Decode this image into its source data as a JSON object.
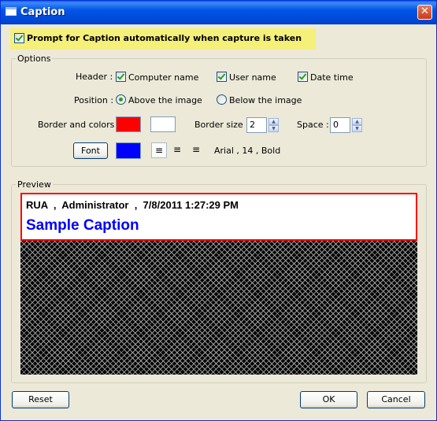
{
  "window": {
    "title": "Caption",
    "close_glyph": "✕"
  },
  "prompt": {
    "label": "Prompt for Caption automatically when capture is taken",
    "checked": true
  },
  "options": {
    "group_label": "Options",
    "header_label": "Header :",
    "header_items": [
      {
        "label": "Computer name",
        "checked": true
      },
      {
        "label": "User name",
        "checked": true
      },
      {
        "label": "Date time",
        "checked": true
      }
    ],
    "position_label": "Position :",
    "position_options": [
      {
        "label": "Above the image",
        "selected": true
      },
      {
        "label": "Below the image",
        "selected": false
      }
    ],
    "border_colors_label": "Border and colors :",
    "border_color": "#FF0000",
    "background_color": "#FFFFFF",
    "border_size_label": "Border size :",
    "border_size_value": "2",
    "space_label": "Space :",
    "space_value": "0",
    "font_button": "Font",
    "font_color": "#0000FF",
    "font_summary": "Arial , 14 , Bold",
    "align_icons": [
      "align-left-icon",
      "align-center-icon",
      "align-right-icon"
    ],
    "align_selected": "left"
  },
  "preview": {
    "group_label": "Preview",
    "header_text": "RUA  ,  Administrator  ,  7/8/2011 1:27:29 PM",
    "caption_text": "Sample Caption",
    "caption_color": "#0000FF",
    "border_color": "#FF0000"
  },
  "buttons": {
    "reset": "Reset",
    "ok": "OK",
    "cancel": "Cancel"
  },
  "colors": {
    "titlebar": "#0055E5",
    "dialog_bg": "#ECE9D8",
    "highlight": "#F5F07A"
  }
}
